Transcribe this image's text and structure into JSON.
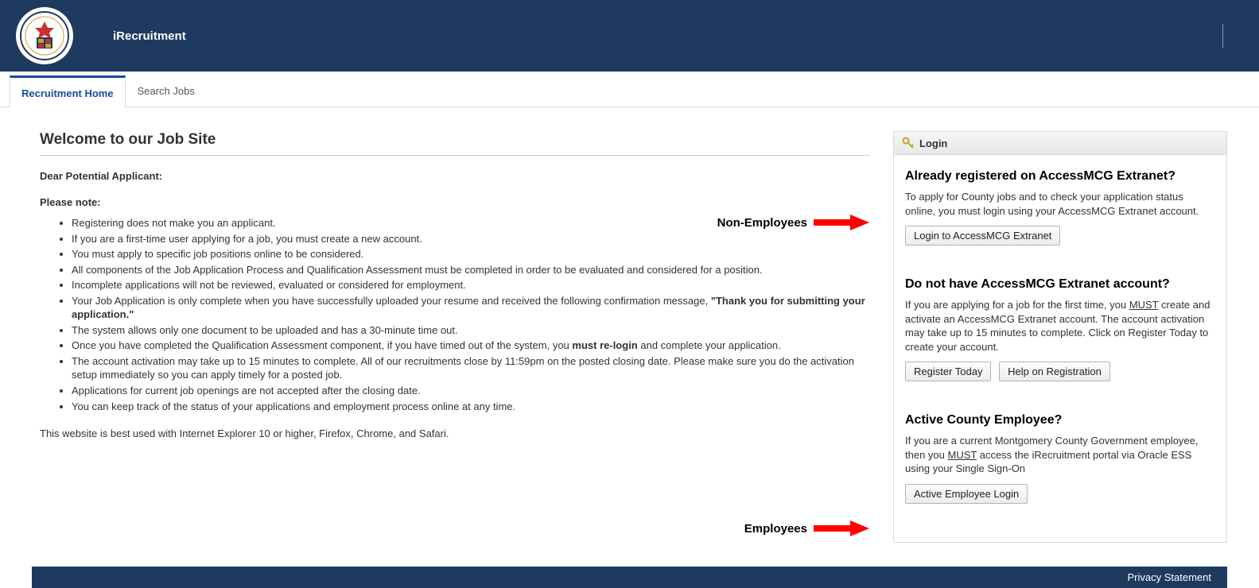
{
  "header": {
    "app_title": "iRecruitment",
    "logo_alt": "Montgomery County Maryland Seal"
  },
  "tabs": {
    "active": "Recruitment Home",
    "other": "Search Jobs"
  },
  "main": {
    "heading": "Welcome to our Job Site",
    "salutation": "Dear Potential Applicant:",
    "please_note": "Please note:",
    "bullets": [
      "Registering does not make you an applicant.",
      "If you are a first-time user applying for a job, you must create a new account.",
      "You must apply to specific job positions online to be considered.",
      "All components of the Job Application Process and Qualification Assessment must be completed in order to be evaluated and considered for a position.",
      "Incomplete applications will not be reviewed, evaluated or considered for employment."
    ],
    "bullet6_pre": "Your Job Application is only complete when you have successfully uploaded your resume and received the following confirmation message, ",
    "bullet6_bold": "\"Thank you for submitting your application.\"",
    "bullets2": [
      "The system allows only one document to be uploaded and has a 30-minute time out."
    ],
    "bullet8_pre": "Once you have completed the Qualification Assessment component, if you have timed out of the system, you ",
    "bullet8_bold": "must re-login",
    "bullet8_post": " and complete your application.",
    "bullets3": [
      "The account activation may take up to 15 minutes to complete. All of our recruitments close by 11:59pm on the posted closing date. Please make sure you do the activation setup immediately so you can apply timely for a posted job.",
      "Applications for current job openings are not accepted after the closing date.",
      "You can keep track of the status of your applications and employment process online at any time."
    ],
    "footnote": "This website is best used with Internet Explorer 10 or higher, Firefox, Chrome, and Safari."
  },
  "annotations": {
    "non_employees": "Non-Employees",
    "employees": "Employees"
  },
  "sidebar": {
    "login_header": "Login",
    "sec1_title": "Already registered on AccessMCG Extranet?",
    "sec1_text": "To apply for County jobs and to check your application status online, you must login using your AccessMCG Extranet account.",
    "btn_login": "Login to AccessMCG Extranet",
    "sec2_title": "Do not have AccessMCG Extranet account?",
    "sec2_pre": "If you are applying for a job for the first time, you ",
    "sec2_must": "MUST",
    "sec2_post": " create and activate an AccessMCG Extranet account. The account activation may take up to 15 minutes to complete. Click on Register Today to create your account.",
    "btn_register": "Register Today",
    "btn_help": "Help on Registration",
    "sec3_title": "Active County Employee?",
    "sec3_pre": "If you are a current Montgomery County Government employee, then you ",
    "sec3_must": "MUST",
    "sec3_post": " access the iRecruitment portal via Oracle ESS using your Single Sign-On",
    "btn_employee": "Active Employee Login"
  },
  "footer": {
    "privacy": "Privacy Statement"
  },
  "colors": {
    "brand_navy": "#1f3a5f",
    "accent_blue": "#1a4a9c",
    "arrow_red": "#ff0000"
  }
}
